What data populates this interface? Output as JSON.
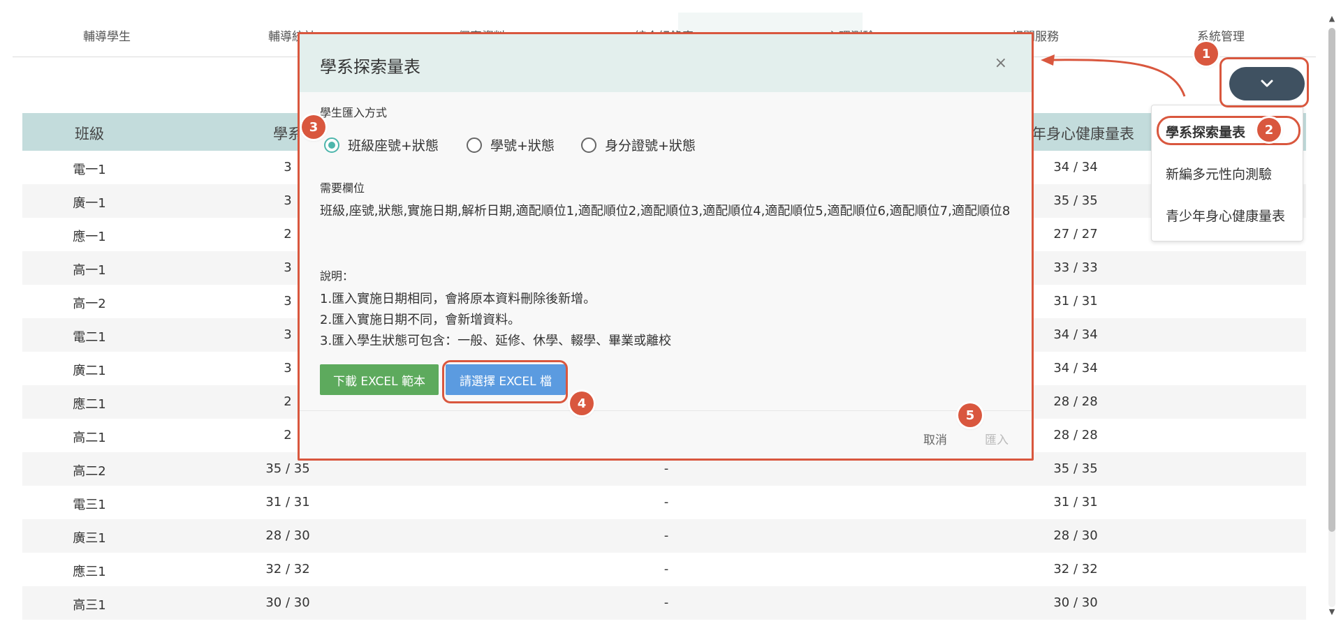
{
  "nav": {
    "tabs": [
      "輔導學生",
      "輔導統計",
      "個案資料",
      "綜合紀錄表",
      "心理測驗",
      "相關服務",
      "系統管理"
    ]
  },
  "table": {
    "headers": [
      "班級",
      "學系",
      "",
      "少年身心健康量表"
    ],
    "rows": [
      {
        "cls": "電一1",
        "c2": "3",
        "c3": "",
        "c4": "34 / 34"
      },
      {
        "cls": "廣一1",
        "c2": "3",
        "c3": "",
        "c4": "35 / 35"
      },
      {
        "cls": "應一1",
        "c2": "2",
        "c3": "",
        "c4": "27 / 27"
      },
      {
        "cls": "高一1",
        "c2": "3",
        "c3": "",
        "c4": "33 / 33"
      },
      {
        "cls": "高一2",
        "c2": "3",
        "c3": "",
        "c4": "31 / 31"
      },
      {
        "cls": "電二1",
        "c2": "3",
        "c3": "",
        "c4": "34 / 34"
      },
      {
        "cls": "廣二1",
        "c2": "3",
        "c3": "",
        "c4": "34 / 34"
      },
      {
        "cls": "應二1",
        "c2": "2",
        "c3": "",
        "c4": "28 / 28"
      },
      {
        "cls": "高二1",
        "c2": "2",
        "c3": "",
        "c4": "28 / 28"
      },
      {
        "cls": "高二2",
        "c2": "35 / 35",
        "c3": "-",
        "c4": "35 / 35"
      },
      {
        "cls": "電三1",
        "c2": "31 / 31",
        "c3": "-",
        "c4": "31 / 31"
      },
      {
        "cls": "廣三1",
        "c2": "28 / 30",
        "c3": "-",
        "c4": "28 / 30"
      },
      {
        "cls": "應三1",
        "c2": "32 / 32",
        "c3": "-",
        "c4": "32 / 32"
      },
      {
        "cls": "高三1",
        "c2": "30 / 30",
        "c3": "-",
        "c4": "30 / 30"
      }
    ]
  },
  "dropdown": {
    "trigger_icon": "chevron-down-icon",
    "items": [
      "學系探索量表",
      "新編多元性向測驗",
      "青少年身心健康量表"
    ]
  },
  "modal": {
    "title": "學系探索量表",
    "close_icon": "×",
    "import_method_label": "學生匯入方式",
    "radios": [
      {
        "label": "班級座號+狀態",
        "checked": true
      },
      {
        "label": "學號+狀態",
        "checked": false
      },
      {
        "label": "身分證號+狀態",
        "checked": false
      }
    ],
    "fields_label": "需要欄位",
    "fields_text": "班級,座號,狀態,實施日期,解析日期,適配順位1,適配順位2,適配順位3,適配順位4,適配順位5,適配順位6,適配順位7,適配順位8",
    "notes_label": "說明：",
    "notes": [
      "1.匯入實施日期相同，會將原本資料刪除後新增。",
      "2.匯入實施日期不同，會新增資料。",
      "3.匯入學生狀態可包含：一般、延修、休學、輟學、畢業或離校"
    ],
    "download_button": "下載 EXCEL 範本",
    "choose_button": "請選擇 EXCEL 檔",
    "cancel_button": "取消",
    "import_button": "匯入"
  },
  "annotations": {
    "accent": "#d9573e",
    "badges": [
      "1",
      "2",
      "3",
      "4",
      "5"
    ]
  },
  "colors": {
    "table_header_bg": "#c3dcdc",
    "modal_header_bg": "#e3efed",
    "dropdown_trigger_bg": "#3f5161",
    "radio_checked": "#4db6ac",
    "download_button_bg": "#5daa5d",
    "choose_button_bg": "#5b9be0"
  }
}
